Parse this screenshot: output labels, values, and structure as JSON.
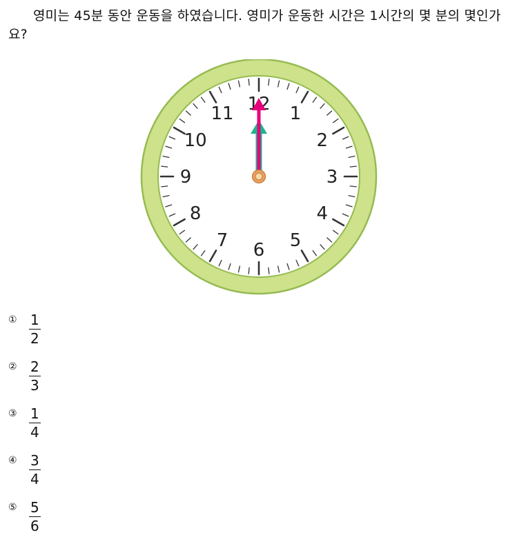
{
  "question": {
    "text": "영미는 45분 동안 운동을 하였습니다. 영미가 운동한 시간은 1시간의 몇 분의 몇인가요?"
  },
  "clock": {
    "numbers": [
      "12",
      "1",
      "2",
      "3",
      "4",
      "5",
      "6",
      "7",
      "8",
      "9",
      "10",
      "11"
    ],
    "hour": 12,
    "minute": 0,
    "colors": {
      "rim": "#cde28a",
      "rim_edge": "#96bb52",
      "face": "#ffffff",
      "ticks": "#333333",
      "minute_hand": "#e8007d",
      "hour_hand": "#1fb38e",
      "pivot": "#e8a060"
    }
  },
  "choices": [
    {
      "marker": "①",
      "numerator": "1",
      "denominator": "2"
    },
    {
      "marker": "②",
      "numerator": "2",
      "denominator": "3"
    },
    {
      "marker": "③",
      "numerator": "1",
      "denominator": "4"
    },
    {
      "marker": "④",
      "numerator": "3",
      "denominator": "4"
    },
    {
      "marker": "⑤",
      "numerator": "5",
      "denominator": "6"
    }
  ]
}
